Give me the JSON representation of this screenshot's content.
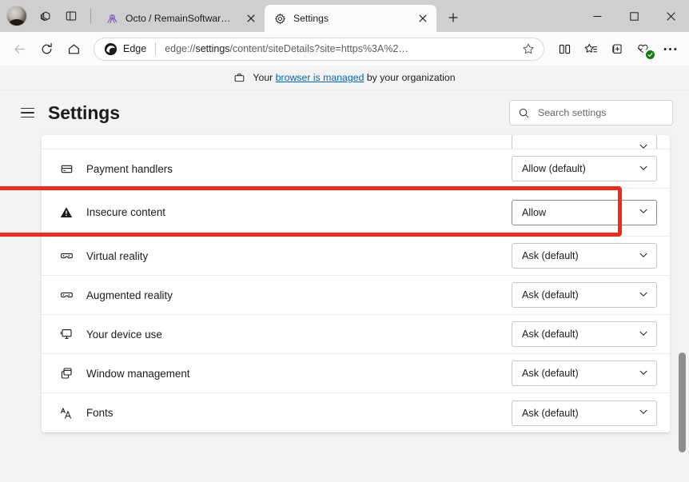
{
  "window": {
    "controls": {
      "minimize": "minimize-button",
      "maximize": "maximize-button",
      "close": "close-button"
    }
  },
  "tabs": [
    {
      "title": "Octo / RemainSoftware.com",
      "active": false,
      "favicon": "octopus-icon"
    },
    {
      "title": "Settings",
      "active": true,
      "favicon": "gear-icon"
    }
  ],
  "toolbar": {
    "back": "back-arrow-icon",
    "refresh": "refresh-icon",
    "home": "home-icon",
    "brand_label": "Edge",
    "url_prefix": "edge://",
    "url_bold": "settings",
    "url_suffix": "/content/siteDetails?site=https%3A%2…",
    "url_full": "edge://settings/content/siteDetails?site=https%3A%2…",
    "favorite": "star-icon",
    "split_screen": "split-screen-icon",
    "favorites_list": "favorites-icon",
    "collections": "collections-icon",
    "browser_essentials": "browser-essentials-icon",
    "more": "more-options-icon",
    "new_tab": "new-tab-plus-icon"
  },
  "managed_banner": {
    "icon": "briefcase-icon",
    "prefix": "Your ",
    "link": "browser is managed",
    "suffix": " by your organization"
  },
  "settings": {
    "menu_icon": "hamburger-menu-icon",
    "title": "Settings",
    "search": {
      "icon": "search-icon",
      "placeholder": "Search settings",
      "value": ""
    }
  },
  "permissions": {
    "rows": [
      {
        "label": "",
        "icon": "clipped-icon",
        "value": "",
        "clipped": true,
        "focused": false
      },
      {
        "label": "Payment handlers",
        "icon": "payment-card-icon",
        "value": "Allow (default)",
        "clipped": false,
        "focused": false
      },
      {
        "label": "Insecure content",
        "icon": "warning-triangle-icon",
        "value": "Allow",
        "clipped": false,
        "focused": true,
        "highlighted": true
      },
      {
        "label": "Virtual reality",
        "icon": "vr-goggles-icon",
        "value": "Ask (default)",
        "clipped": false,
        "focused": false
      },
      {
        "label": "Augmented reality",
        "icon": "ar-goggles-icon",
        "value": "Ask (default)",
        "clipped": false,
        "focused": false
      },
      {
        "label": "Your device use",
        "icon": "monitor-icon",
        "value": "Ask (default)",
        "clipped": false,
        "focused": false
      },
      {
        "label": "Window management",
        "icon": "windows-stack-icon",
        "value": "Ask (default)",
        "clipped": false,
        "focused": false
      },
      {
        "label": "Fonts",
        "icon": "fonts-aa-icon",
        "value": "Ask (default)",
        "clipped": false,
        "focused": false
      }
    ]
  },
  "colors": {
    "highlight": "#f02b1d",
    "link": "#0067b8",
    "titlebar": "#cfcfcf",
    "page_bg": "#f3f3f3",
    "card_bg": "#ffffff"
  },
  "scrollbar": {
    "name": "page-scrollbar"
  }
}
